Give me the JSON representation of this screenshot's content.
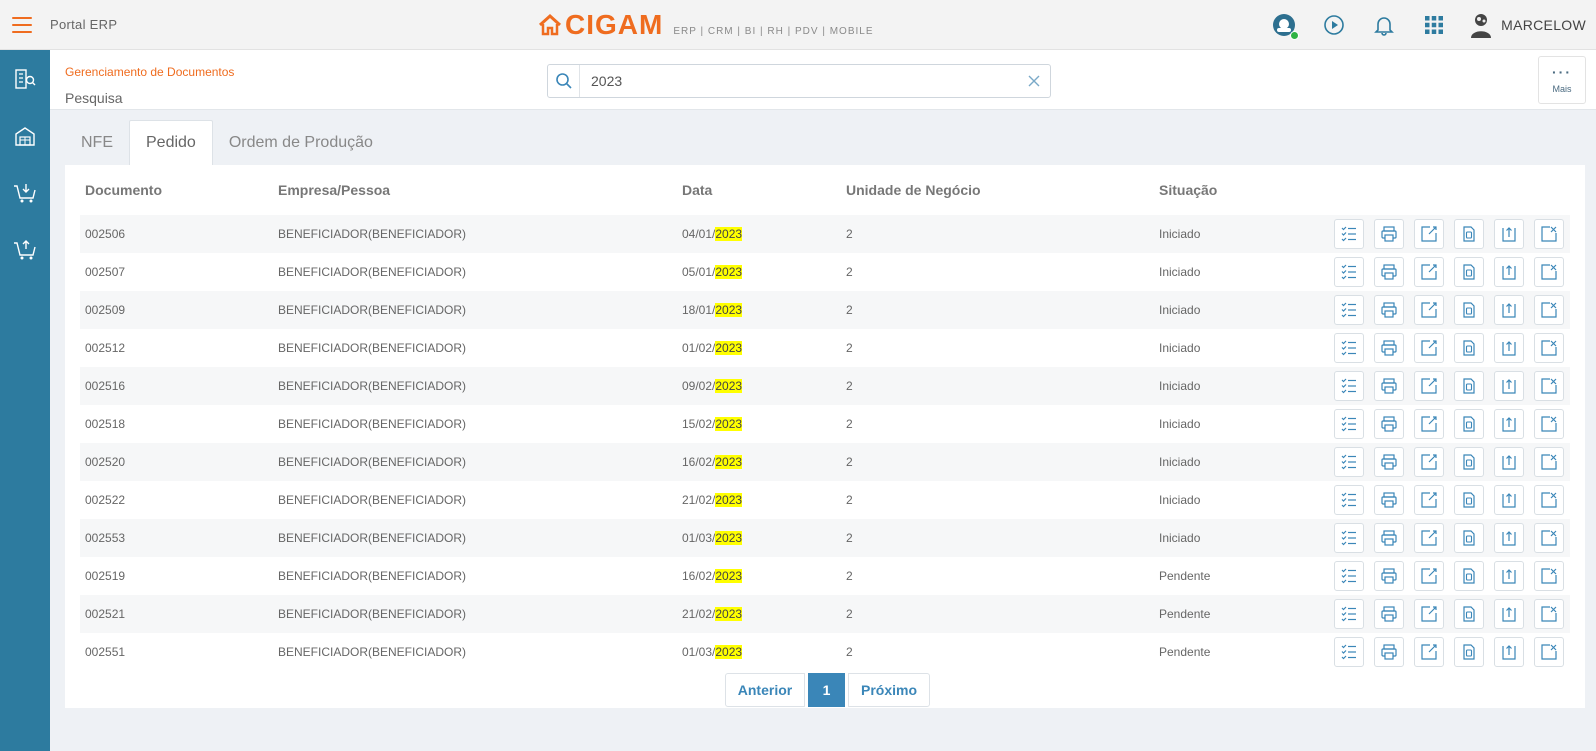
{
  "header": {
    "app_name": "Portal ERP",
    "brand": "CIGAM",
    "brand_sub": "ERP | CRM | BI | RH | PDV | MOBILE",
    "user_name": "MARCELOW"
  },
  "page": {
    "breadcrumb": "Gerenciamento de Documentos",
    "title": "Pesquisa",
    "more_label": "Mais",
    "more_dots": "···"
  },
  "search": {
    "value": "2023",
    "placeholder": ""
  },
  "tabs": [
    {
      "label": "NFE",
      "active": false
    },
    {
      "label": "Pedido",
      "active": true
    },
    {
      "label": "Ordem de Produção",
      "active": false
    }
  ],
  "table": {
    "headers": [
      "Documento",
      "Empresa/Pessoa",
      "Data",
      "Unidade de Negócio",
      "Situação"
    ],
    "highlight": "2023",
    "rows": [
      {
        "documento": "002506",
        "empresa": "BENEFICIADOR(BENEFICIADOR)",
        "data_prefix": "04/01/",
        "data_year": "2023",
        "unidade": "2",
        "situacao": "Iniciado"
      },
      {
        "documento": "002507",
        "empresa": "BENEFICIADOR(BENEFICIADOR)",
        "data_prefix": "05/01/",
        "data_year": "2023",
        "unidade": "2",
        "situacao": "Iniciado"
      },
      {
        "documento": "002509",
        "empresa": "BENEFICIADOR(BENEFICIADOR)",
        "data_prefix": "18/01/",
        "data_year": "2023",
        "unidade": "2",
        "situacao": "Iniciado"
      },
      {
        "documento": "002512",
        "empresa": "BENEFICIADOR(BENEFICIADOR)",
        "data_prefix": "01/02/",
        "data_year": "2023",
        "unidade": "2",
        "situacao": "Iniciado"
      },
      {
        "documento": "002516",
        "empresa": "BENEFICIADOR(BENEFICIADOR)",
        "data_prefix": "09/02/",
        "data_year": "2023",
        "unidade": "2",
        "situacao": "Iniciado"
      },
      {
        "documento": "002518",
        "empresa": "BENEFICIADOR(BENEFICIADOR)",
        "data_prefix": "15/02/",
        "data_year": "2023",
        "unidade": "2",
        "situacao": "Iniciado"
      },
      {
        "documento": "002520",
        "empresa": "BENEFICIADOR(BENEFICIADOR)",
        "data_prefix": "16/02/",
        "data_year": "2023",
        "unidade": "2",
        "situacao": "Iniciado"
      },
      {
        "documento": "002522",
        "empresa": "BENEFICIADOR(BENEFICIADOR)",
        "data_prefix": "21/02/",
        "data_year": "2023",
        "unidade": "2",
        "situacao": "Iniciado"
      },
      {
        "documento": "002553",
        "empresa": "BENEFICIADOR(BENEFICIADOR)",
        "data_prefix": "01/03/",
        "data_year": "2023",
        "unidade": "2",
        "situacao": "Iniciado"
      },
      {
        "documento": "002519",
        "empresa": "BENEFICIADOR(BENEFICIADOR)",
        "data_prefix": "16/02/",
        "data_year": "2023",
        "unidade": "2",
        "situacao": "Pendente"
      },
      {
        "documento": "002521",
        "empresa": "BENEFICIADOR(BENEFICIADOR)",
        "data_prefix": "21/02/",
        "data_year": "2023",
        "unidade": "2",
        "situacao": "Pendente"
      },
      {
        "documento": "002551",
        "empresa": "BENEFICIADOR(BENEFICIADOR)",
        "data_prefix": "01/03/",
        "data_year": "2023",
        "unidade": "2",
        "situacao": "Pendente"
      }
    ],
    "row_actions": [
      "checklist-icon",
      "print-icon",
      "edit-icon",
      "document-icon",
      "upload-icon",
      "cancel-icon"
    ]
  },
  "pagination": {
    "prev_label": "Anterior",
    "current": "1",
    "next_label": "Próximo"
  },
  "colors": {
    "accent": "#ef6c1f",
    "sidebar": "#2d7b9f",
    "link": "#3a86b8",
    "highlight": "#ffff00"
  }
}
